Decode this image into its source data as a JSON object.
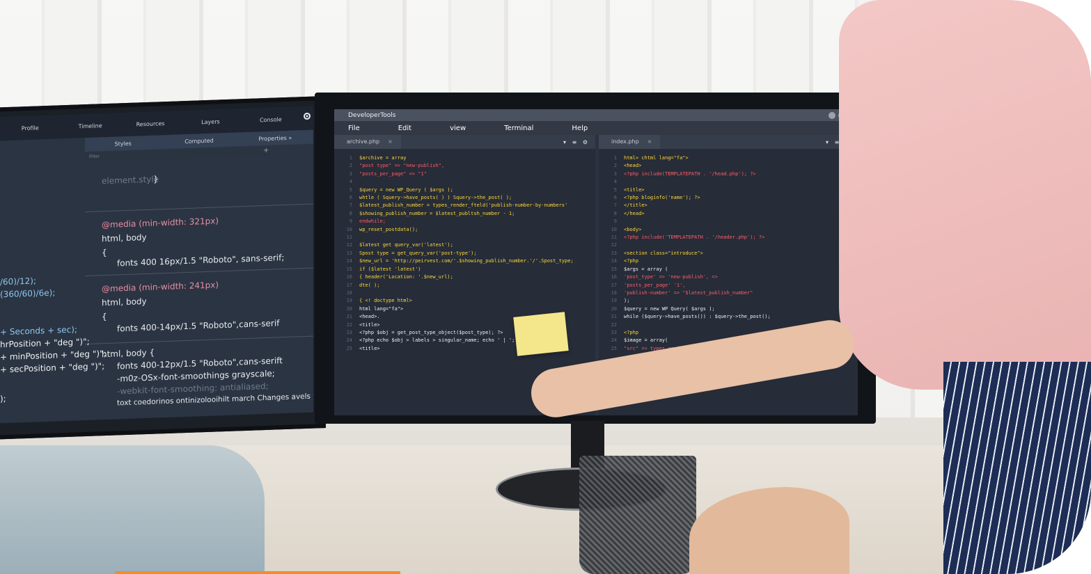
{
  "left_monitor": {
    "tabs": [
      "Profile",
      "Timeline",
      "Resources",
      "Layers",
      "Console"
    ],
    "subtabs": [
      "Styles",
      "Computed",
      "Properties »"
    ],
    "filter_placeholder": "Filter",
    "plus": "+",
    "panels": [
      {
        "lines": [
          "element.style",
          "}"
        ]
      },
      {
        "lines": [
          "@media (min-width: 321px)",
          "html, body",
          "{",
          "fonts 400 16px/1.5 \"Roboto\", sans-serif;"
        ]
      },
      {
        "lines": [
          "@media (min-width: 241px)",
          "html, body",
          "{",
          "fonts 400-14px/1.5 \"Roboto\",cans-serif"
        ]
      },
      {
        "lines": [
          "html, body {",
          "fonts 400-12px/1.5 \"Roboto\",cans-serift",
          "-m0z-OSx-font-smoothings grayscale;",
          "-webkit-font-smoothing: antialiased;",
          "toxt coedorinos ontinizolooihilt march Changes avels v"
        ]
      }
    ],
    "left_code": [
      "/60)/12);",
      "(360/60)/6e);",
      "+ Seconds + sec);",
      "hrPosition + \"deg \")\";",
      "+ minPosition + \"deg \")\";",
      "+ secPosition + \"deg \")\";",
      ");"
    ]
  },
  "main_monitor": {
    "title": "DeveloperTools",
    "menu": [
      "File",
      "Edit",
      "view",
      "Terminal",
      "Help"
    ],
    "left_tab": "archive.php",
    "right_tab": "index.php",
    "tab_close": "×",
    "tab_tools": "▾ ≡ ⚙",
    "left_code": [
      {
        "n": "1",
        "t": "$archive = array"
      },
      {
        "n": "2",
        "t": "  \"post type\"          => \"new-publish\","
      },
      {
        "n": "3",
        "t": "  \"posts_per_page\"     => \"1\""
      },
      {
        "n": "4",
        "t": ""
      },
      {
        "n": "5",
        "t": "$query = new WP_Query ( $args );"
      },
      {
        "n": "6",
        "t": "whtle ( Squery->have_posts( ) )   Squery->the_post( );"
      },
      {
        "n": "7",
        "t": "   $latest_publish_number     = types_render_fteld('publish-number-by-numbers'"
      },
      {
        "n": "8",
        "t": "   $showing_publish_number    = $latest_publtsh_number - 1;"
      },
      {
        "n": "9",
        "t": "endwhile;"
      },
      {
        "n": "10",
        "t": "wp_reset_postdata();"
      },
      {
        "n": "11",
        "t": ""
      },
      {
        "n": "12",
        "t": "$latest get query_var('latest');"
      },
      {
        "n": "13",
        "t": "Spost type  = get_query_var('post-type');"
      },
      {
        "n": "14",
        "t": "$new_url = 'http://peirvest.com/'.$showing_publish_number.'/'.Spost_type;"
      },
      {
        "n": "15",
        "t": "if ($latest 'latest')"
      },
      {
        "n": "16",
        "t": "{ header('Location: '.$new_url);"
      },
      {
        "n": "17",
        "t": "dte( );"
      },
      {
        "n": "18",
        "t": ""
      },
      {
        "n": "19",
        "t": "{ <! doctype html>"
      },
      {
        "n": "20",
        "t": "html lang=\"fa\">"
      },
      {
        "n": "21",
        "t": "<head>."
      },
      {
        "n": "22",
        "t": "<title>"
      },
      {
        "n": "23",
        "t": "   <?php $obj = get_post_type_object($post_type); ?>"
      },
      {
        "n": "24",
        "t": "   <?php echo $obj > labels > singular_name; echo ' | '; bloginfo"
      },
      {
        "n": "25",
        "t": "<title>"
      }
    ],
    "right_code": [
      {
        "n": "1",
        "t": "html> chtml lang=\"fa\">"
      },
      {
        "n": "2",
        "t": "<head>"
      },
      {
        "n": "3",
        "t": "       <?php include(TEMPLATEPATH . '/head.php'); ?>"
      },
      {
        "n": "4",
        "t": ""
      },
      {
        "n": "5",
        "t": "   <title>"
      },
      {
        "n": "6",
        "t": "       <?php bloginfo('name'); ?>"
      },
      {
        "n": "7",
        "t": "   </title>"
      },
      {
        "n": "8",
        "t": "</head>"
      },
      {
        "n": "9",
        "t": ""
      },
      {
        "n": "10",
        "t": "<body>"
      },
      {
        "n": "11",
        "t": "     <?php include('TEMPLATEPATH . '/header.php'); ?>"
      },
      {
        "n": "12",
        "t": ""
      },
      {
        "n": "13",
        "t": "<section class=\"introduce\">"
      },
      {
        "n": "14",
        "t": "   <?php"
      },
      {
        "n": "15",
        "t": "   $args = array ("
      },
      {
        "n": "16",
        "t": "     'post_type'            => 'new-publish', =>"
      },
      {
        "n": "17",
        "t": "     'posts_per_page'       '1',"
      },
      {
        "n": "18",
        "t": "     'publish-number'       => \"$latest_publish_number\""
      },
      {
        "n": "19",
        "t": ");"
      },
      {
        "n": "20",
        "t": " $query = new WP Query( $args );"
      },
      {
        "n": "21",
        "t": " while ($query->have_posts()) : $query->the_post();"
      },
      {
        "n": "22",
        "t": ""
      },
      {
        "n": "23",
        "t": "       <?php"
      },
      {
        "n": "24",
        "t": "       $image = array("
      },
      {
        "n": "25",
        "t": "       \"src\" => types_render_field(\"main-cover-edited\", array( \"output\""
      }
    ]
  }
}
